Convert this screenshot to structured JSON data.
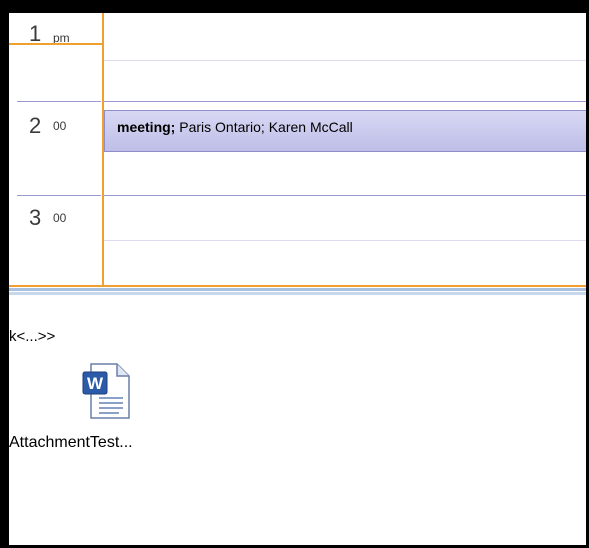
{
  "calendar": {
    "hours": [
      {
        "hour": "1",
        "suffix": "pm"
      },
      {
        "hour": "2",
        "suffix": "00"
      },
      {
        "hour": "3",
        "suffix": "00"
      }
    ],
    "appointment": {
      "subject": "meeting;",
      "details": " Paris Ontario; Karen McCall"
    }
  },
  "preview": {
    "text": "k<...>>",
    "attachment": {
      "icon": "word-document-icon",
      "name": "AttachmentTest..."
    }
  },
  "colors": {
    "current_time_accent": "#f0a030",
    "appointment_fill": "#c8c8ec",
    "hour_divider": "#9a9ad0"
  }
}
